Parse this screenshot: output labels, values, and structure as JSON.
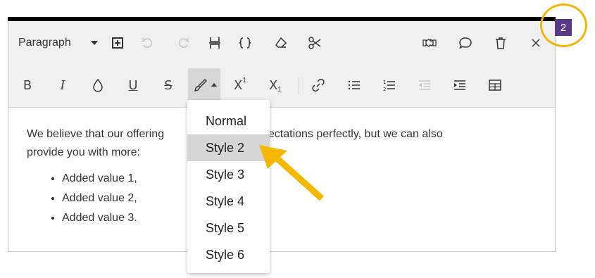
{
  "toolbar": {
    "block_format": "Paragraph",
    "row1_icons": [
      "add-block-icon",
      "undo-icon",
      "redo-icon",
      "page-break-icon",
      "code-icon",
      "clear-format-icon",
      "cut-icon",
      "handshake-icon",
      "comment-icon",
      "delete-icon",
      "close-icon"
    ],
    "row2_icons": [
      "bold-icon",
      "italic-icon",
      "color-drop-icon",
      "underline-icon",
      "strikethrough-icon",
      "highlight-brush-icon",
      "superscript-icon",
      "subscript-icon",
      "link-icon",
      "bullet-list-icon",
      "numbered-list-icon",
      "outdent-icon",
      "indent-icon",
      "table-icon"
    ],
    "bold": "B",
    "italic": "I",
    "underline": "U",
    "strike": "S",
    "sup_base": "X",
    "sup_mark": "1",
    "sub_base": "X",
    "sub_mark": "1"
  },
  "content": {
    "paragraph_start": "We believe that our offering",
    "paragraph_end": "expectations perfectly, but we can also",
    "paragraph_line2": "provide you with more:",
    "items": [
      "Added value 1,",
      "Added value 2,",
      "Added value 3."
    ]
  },
  "style_menu": {
    "options": [
      "Normal",
      "Style 2",
      "Style 3",
      "Style 4",
      "Style 5",
      "Style 6"
    ],
    "selected": "Style 2"
  },
  "annotation": {
    "step": "2",
    "ring_color": "#f2b705",
    "badge_color": "#5a3a86",
    "arrow_color": "#f5b800"
  }
}
